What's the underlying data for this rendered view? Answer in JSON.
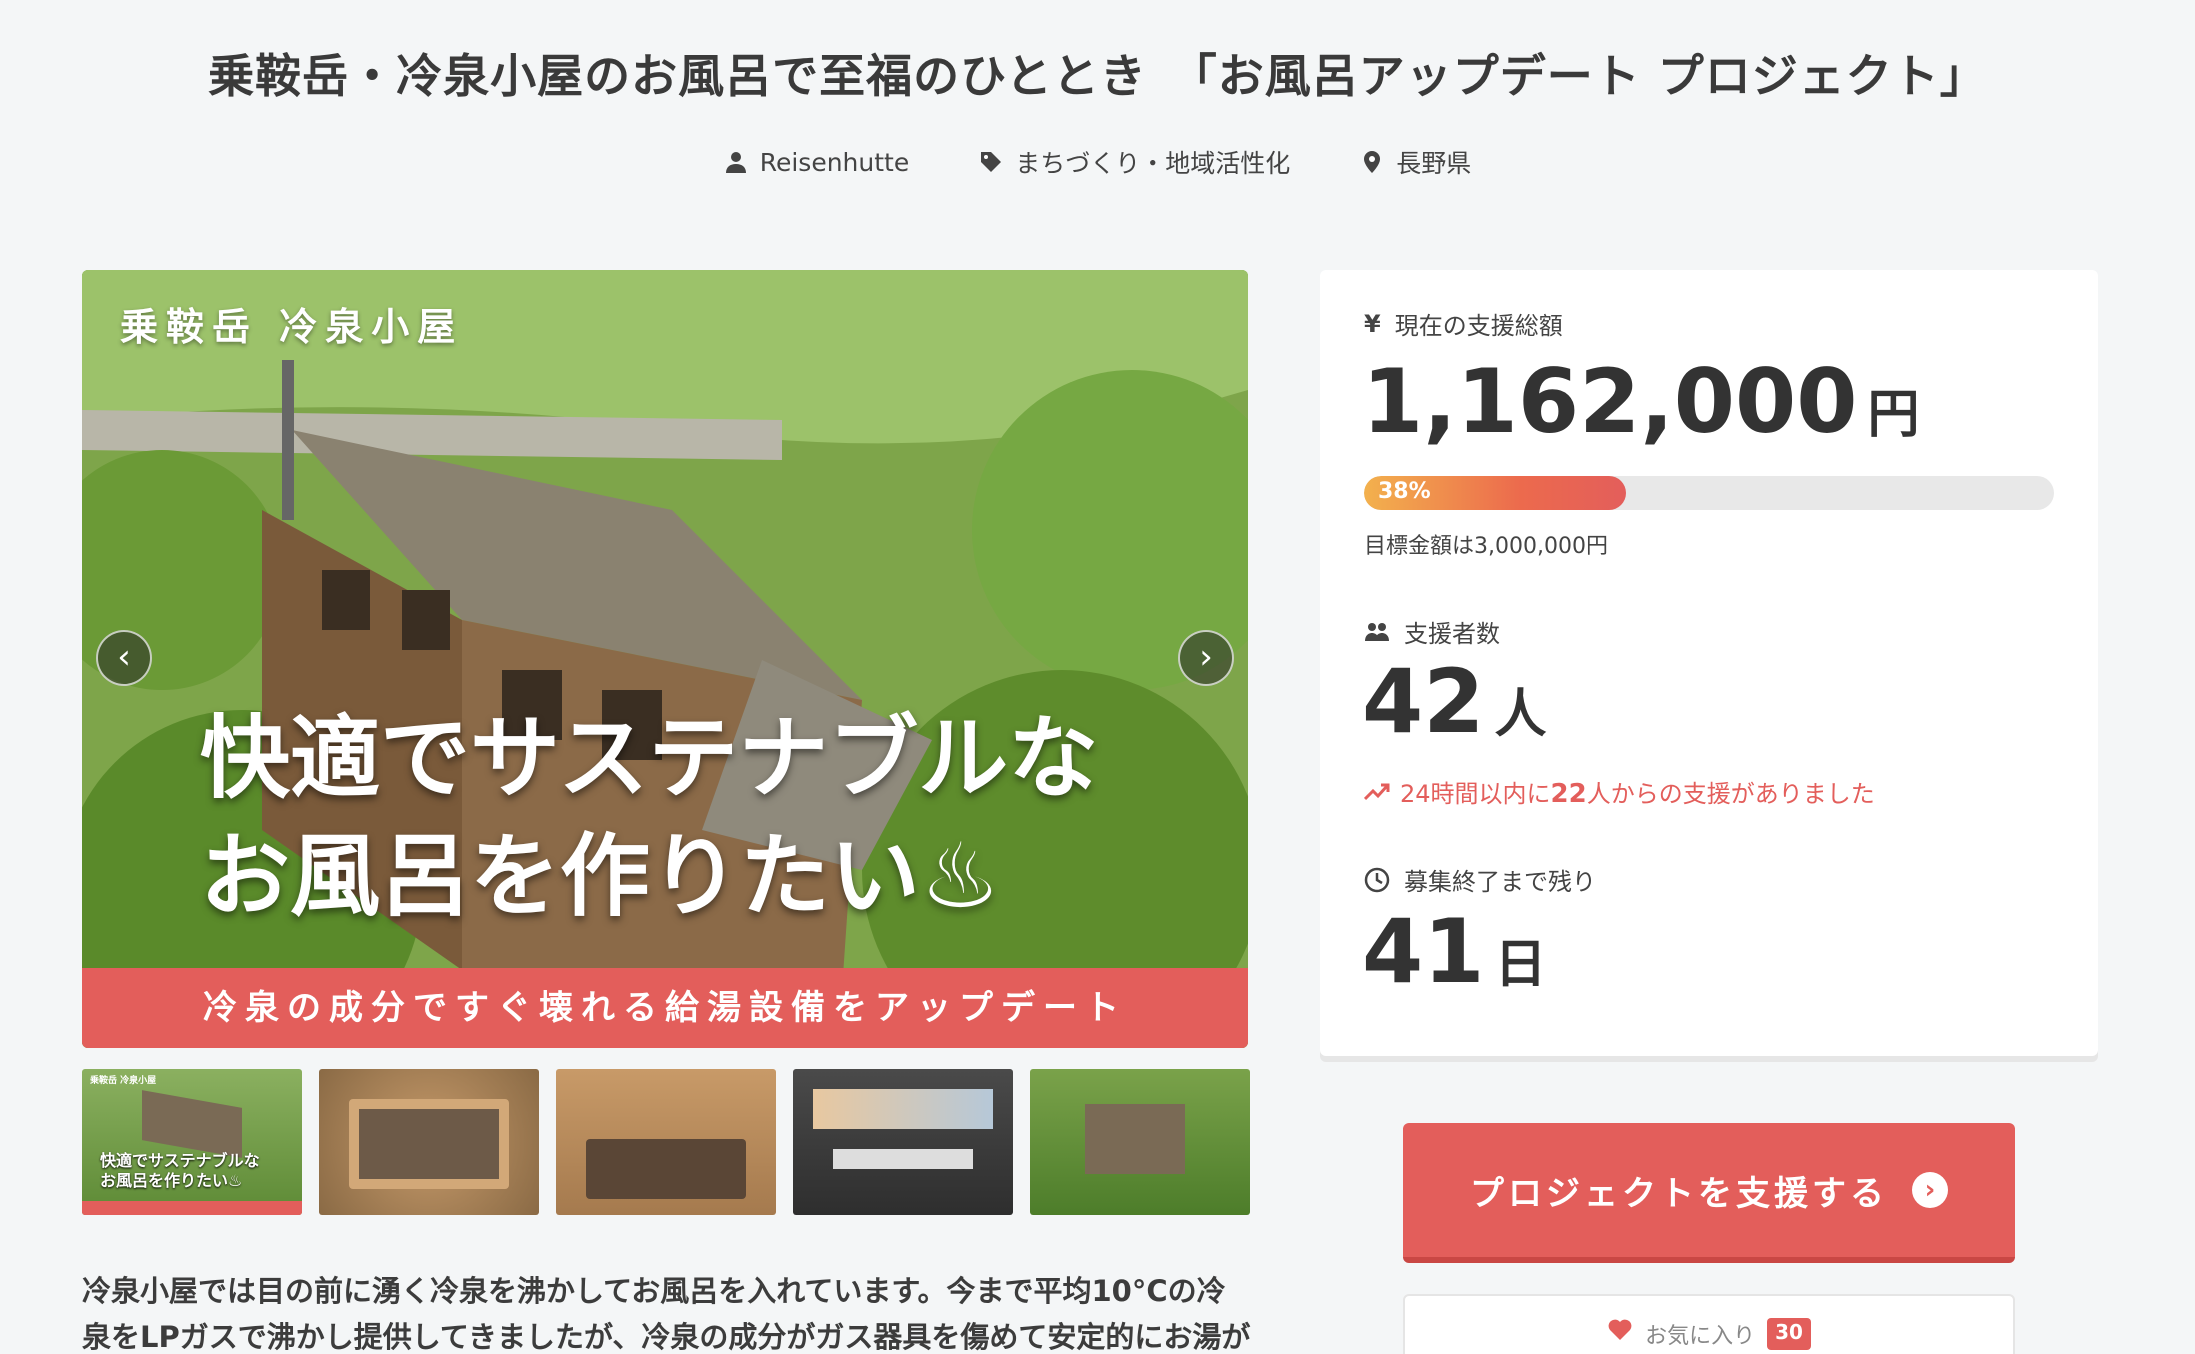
{
  "project": {
    "title": "乗鞍岳・冷泉小屋のお風呂で至福のひととき　「お風呂アップデート プロジェクト」",
    "owner": "Reisenhutte",
    "category": "まちづくり・地域活性化",
    "location": "長野県"
  },
  "hero": {
    "brand": "乗鞍岳 冷泉小屋",
    "headline_line1": "快適でサステナブルな",
    "headline_line2": "お風呂を作りたい♨",
    "ribbon": "冷泉の成分ですぐ壊れる給湯設備をアップデート",
    "prev_arrow": "‹",
    "next_arrow": "›"
  },
  "thumbnails": [
    {
      "caption_line1": "快適でサステナブルな",
      "caption_line2": "お風呂を作りたい♨",
      "small_brand": "乗鞍岳 冷泉小屋"
    },
    {
      "caption_line1": ""
    },
    {
      "caption_line1": ""
    },
    {
      "caption_line1": ""
    },
    {
      "caption_line1": ""
    }
  ],
  "description": "冷泉小屋では目の前に湧く冷泉を沸かしてお風呂を入れています。今まで平均10°Cの冷泉をLPガスで沸かし提供してきましたが、冷泉の成分がガス器具を傷めて安定的にお湯が沸",
  "stats": {
    "total_label": "現在の支援総額",
    "total_amount": "1,162,000",
    "total_unit": "円",
    "progress_percent": 38,
    "progress_label": "38%",
    "goal_text": "目標金額は3,000,000円",
    "backers_label": "支援者数",
    "backers_count": "42",
    "backers_unit": "人",
    "trend_prefix": "24時間以内に",
    "trend_count": "22",
    "trend_suffix": "人からの支援がありました",
    "remaining_label": "募集終了まで残り",
    "remaining_days": "41",
    "remaining_unit": "日"
  },
  "actions": {
    "support_label": "プロジェクトを支援する",
    "favorite_label": "お気に入り",
    "favorite_count": "30"
  },
  "colors": {
    "accent": "#e35e5b",
    "background": "#f4f6f7"
  }
}
